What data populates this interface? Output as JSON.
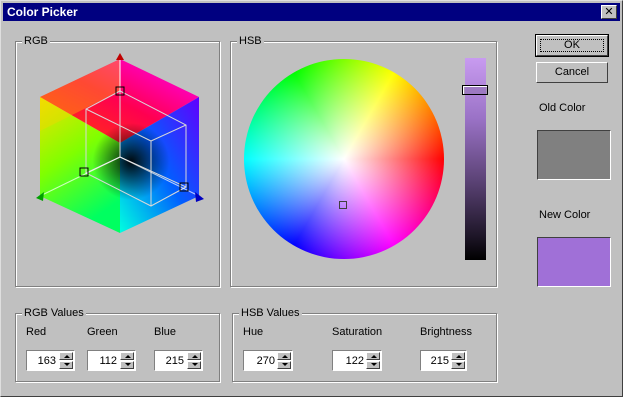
{
  "window": {
    "title": "Color Picker"
  },
  "buttons": {
    "ok": "OK",
    "cancel": "Cancel"
  },
  "labels": {
    "old_color": "Old Color",
    "new_color": "New Color"
  },
  "colors": {
    "old_color": "#808080",
    "new_color": "#a070d7"
  },
  "rgb_group": {
    "label": "RGB"
  },
  "hsb_group": {
    "label": "HSB"
  },
  "rgb_values": {
    "label": "RGB Values",
    "red": {
      "label": "Red",
      "value": "163"
    },
    "green": {
      "label": "Green",
      "value": "112"
    },
    "blue": {
      "label": "Blue",
      "value": "215"
    }
  },
  "hsb_values": {
    "label": "HSB Values",
    "hue": {
      "label": "Hue",
      "value": "270"
    },
    "saturation": {
      "label": "Saturation",
      "value": "122"
    },
    "brightness": {
      "label": "Brightness",
      "value": "215"
    }
  }
}
